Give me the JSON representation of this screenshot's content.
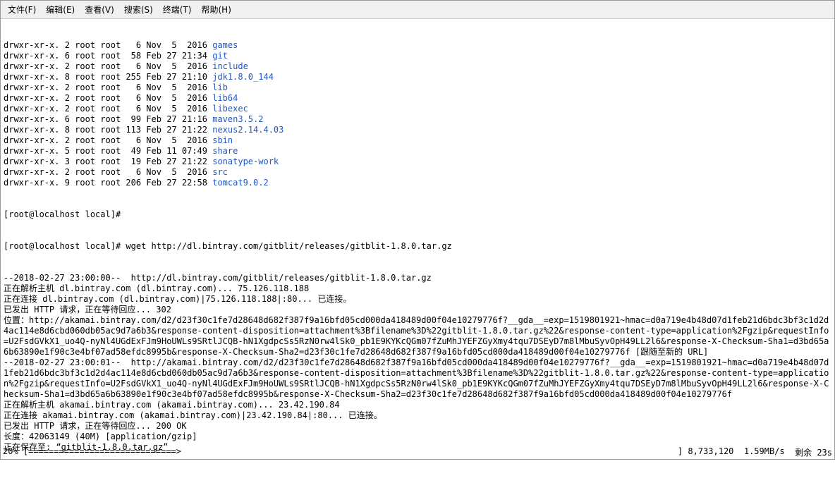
{
  "menu": {
    "file": "文件(F)",
    "edit": "编辑(E)",
    "view": "查看(V)",
    "search": "搜索(S)",
    "terminal": "终端(T)",
    "help": "帮助(H)"
  },
  "listing": [
    {
      "perm": "drwxr-xr-x. 2 root root   6 Nov  5  2016 ",
      "name": "games"
    },
    {
      "perm": "drwxr-xr-x. 6 root root  58 Feb 27 21:34 ",
      "name": "git"
    },
    {
      "perm": "drwxr-xr-x. 2 root root   6 Nov  5  2016 ",
      "name": "include"
    },
    {
      "perm": "drwxr-xr-x. 8 root root 255 Feb 27 21:10 ",
      "name": "jdk1.8.0_144"
    },
    {
      "perm": "drwxr-xr-x. 2 root root   6 Nov  5  2016 ",
      "name": "lib"
    },
    {
      "perm": "drwxr-xr-x. 2 root root   6 Nov  5  2016 ",
      "name": "lib64"
    },
    {
      "perm": "drwxr-xr-x. 2 root root   6 Nov  5  2016 ",
      "name": "libexec"
    },
    {
      "perm": "drwxr-xr-x. 6 root root  99 Feb 27 21:16 ",
      "name": "maven3.5.2"
    },
    {
      "perm": "drwxr-xr-x. 8 root root 113 Feb 27 21:22 ",
      "name": "nexus2.14.4.03"
    },
    {
      "perm": "drwxr-xr-x. 2 root root   6 Nov  5  2016 ",
      "name": "sbin"
    },
    {
      "perm": "drwxr-xr-x. 5 root root  49 Feb 11 07:49 ",
      "name": "share"
    },
    {
      "perm": "drwxr-xr-x. 3 root root  19 Feb 27 21:22 ",
      "name": "sonatype-work"
    },
    {
      "perm": "drwxr-xr-x. 2 root root   6 Nov  5  2016 ",
      "name": "src"
    },
    {
      "perm": "drwxr-xr-x. 9 root root 206 Feb 27 22:58 ",
      "name": "tomcat9.0.2"
    }
  ],
  "prompt1": "[root@localhost local]# ",
  "prompt2": "[root@localhost local]# wget http://dl.bintray.com/gitblit/releases/gitblit-1.8.0.tar.gz",
  "lines": [
    "--2018-02-27 23:00:00--  http://dl.bintray.com/gitblit/releases/gitblit-1.8.0.tar.gz",
    "正在解析主机 dl.bintray.com (dl.bintray.com)... 75.126.118.188",
    "正在连接 dl.bintray.com (dl.bintray.com)|75.126.118.188|:80... 已连接。",
    "已发出 HTTP 请求，正在等待回应... 302",
    "位置：http://akamai.bintray.com/d2/d23f30c1fe7d28648d682f387f9a16bfd05cd000da418489d00f04e10279776f?__gda__=exp=1519801921~hmac=d0a719e4b48d07d1feb21d6bdc3bf3c1d2d4ac114e8d6cbd060db05ac9d7a6b3&response-content-disposition=attachment%3Bfilename%3D%22gitblit-1.8.0.tar.gz%22&response-content-type=application%2Fgzip&requestInfo=U2FsdGVkX1_uo4Q-nyNl4UGdExFJm9HoUWLs9SRtlJCQB-hN1XgdpcSs5RzN0rw4lSk0_pb1E9KYKcQGm07fZuMhJYEFZGyXmy4tqu7DSEyD7m8lMbuSyvOpH49LL2l6&response-X-Checksum-Sha1=d3bd65a6b63890e1f90c3e4bf07ad58efdc8995b&response-X-Checksum-Sha2=d23f30c1fe7d28648d682f387f9a16bfd05cd000da418489d00f04e10279776f [跟随至新的 URL]",
    "--2018-02-27 23:00:01--  http://akamai.bintray.com/d2/d23f30c1fe7d28648d682f387f9a16bfd05cd000da418489d00f04e10279776f?__gda__=exp=1519801921~hmac=d0a719e4b48d07d1feb21d6bdc3bf3c1d2d4ac114e8d6cbd060db05ac9d7a6b3&response-content-disposition=attachment%3Bfilename%3D%22gitblit-1.8.0.tar.gz%22&response-content-type=application%2Fgzip&requestInfo=U2FsdGVkX1_uo4Q-nyNl4UGdExFJm9HoUWLs9SRtlJCQB-hN1XgdpcSs5RzN0rw4lSk0_pb1E9KYKcQGm07fZuMhJYEFZGyXmy4tqu7DSEyD7m8lMbuSyvOpH49LL2l6&response-X-Checksum-Sha1=d3bd65a6b63890e1f90c3e4bf07ad58efdc8995b&response-X-Checksum-Sha2=d23f30c1fe7d28648d682f387f9a16bfd05cd000da418489d00f04e10279776f",
    "正在解析主机 akamai.bintray.com (akamai.bintray.com)... 23.42.190.84",
    "正在连接 akamai.bintray.com (akamai.bintray.com)|23.42.190.84|:80... 已连接。",
    "已发出 HTTP 请求，正在等待回应... 200 OK",
    "长度：42063149 (40M) [application/gzip]",
    "正在保存至: “gitblit-1.8.0.tar.gz”"
  ],
  "progress": {
    "percent": "20%",
    "bar_left": " [",
    "bar_fill": "=============================>",
    "bar_right": "                                                                                                           ]",
    "bytes": " 8,733,120",
    "speed": "  1.59MB/s",
    "eta": "  剩余 23s"
  },
  "watermark": ""
}
